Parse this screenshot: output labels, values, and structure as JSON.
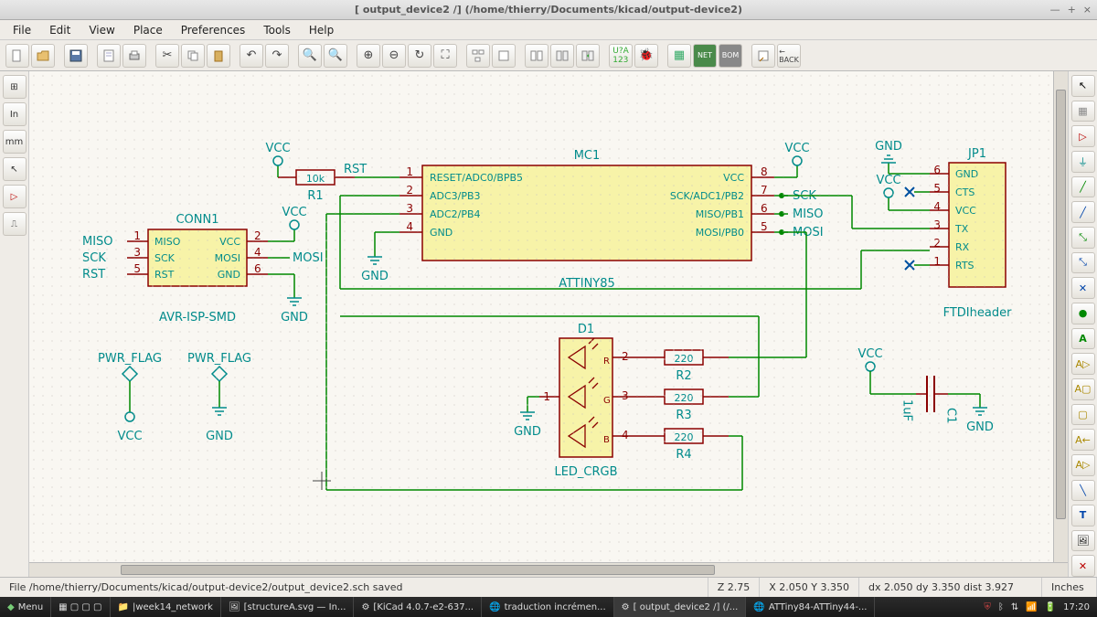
{
  "title": "[ output_device2 /] (/home/thierry/Documents/kicad/output-device2)",
  "menus": [
    "File",
    "Edit",
    "View",
    "Place",
    "Preferences",
    "Tools",
    "Help"
  ],
  "ltool": {
    "grid": "⊞",
    "in": "In",
    "mm": "mm",
    "arrow": "↖",
    "amp": "▷",
    "pulse": "⎍"
  },
  "status": {
    "file": "File /home/thierry/Documents/kicad/output-device2/output_device2.sch saved",
    "z": "Z 2.75",
    "xy": "X 2.050  Y 3.350",
    "dxy": "dx 2.050  dy 3.350  dist 3.927",
    "units": "Inches"
  },
  "taskbar": {
    "menu": "Menu",
    "items": [
      "|week14_network",
      "[structureA.svg — In...",
      "[KiCad 4.0.7-e2-637...",
      "traduction incrémen...",
      "[ output_device2 /] (/...",
      "ATTiny84-ATTiny44-..."
    ],
    "time": "17:20"
  },
  "sch": {
    "conn1": {
      "ref": "CONN1",
      "name": "AVR-ISP-SMD",
      "pins": {
        "1": "MISO",
        "2": "VCC",
        "3": "SCK",
        "4": "MOSI",
        "5": "RST",
        "6": "GND"
      },
      "left": [
        "MISO",
        "SCK",
        "RST"
      ],
      "right": [
        "VCC",
        "MOSI"
      ]
    },
    "mc1": {
      "ref": "MC1",
      "name": "ATTINY85",
      "left": [
        {
          "n": "1",
          "t": "RESET/ADC0/BPB5"
        },
        {
          "n": "2",
          "t": "ADC3/PB3"
        },
        {
          "n": "3",
          "t": "ADC2/PB4"
        },
        {
          "n": "4",
          "t": "GND"
        }
      ],
      "right": [
        {
          "n": "8",
          "t": "VCC"
        },
        {
          "n": "7",
          "t": "SCK/ADC1/PB2"
        },
        {
          "n": "6",
          "t": "MISO/PB1"
        },
        {
          "n": "5",
          "t": "MOSI/PB0"
        }
      ],
      "rlabels": [
        "",
        "SCK",
        "MISO",
        "MOSI"
      ]
    },
    "jp1": {
      "ref": "JP1",
      "name": "FTDIheader",
      "pins": [
        {
          "n": "6",
          "t": "GND"
        },
        {
          "n": "5",
          "t": "CTS"
        },
        {
          "n": "4",
          "t": "VCC"
        },
        {
          "n": "3",
          "t": "TX"
        },
        {
          "n": "2",
          "t": "RX"
        },
        {
          "n": "1",
          "t": "RTS"
        }
      ]
    },
    "r1": {
      "ref": "R1",
      "val": "10k",
      "net": "RST"
    },
    "r2": {
      "ref": "R2",
      "val": "220"
    },
    "r3": {
      "ref": "R3",
      "val": "220"
    },
    "r4": {
      "ref": "R4",
      "val": "220"
    },
    "d1": {
      "ref": "D1",
      "name": "LED_CRGB",
      "pins": {
        "anode": "1",
        "r": "2",
        "g": "3",
        "b": "4"
      },
      "ch": [
        "R",
        "G",
        "B"
      ]
    },
    "c1": {
      "ref": "C1",
      "val": "1uF"
    },
    "pwr": {
      "vcc": "VCC",
      "gnd": "GND",
      "pflag": "PWR_FLAG"
    }
  }
}
